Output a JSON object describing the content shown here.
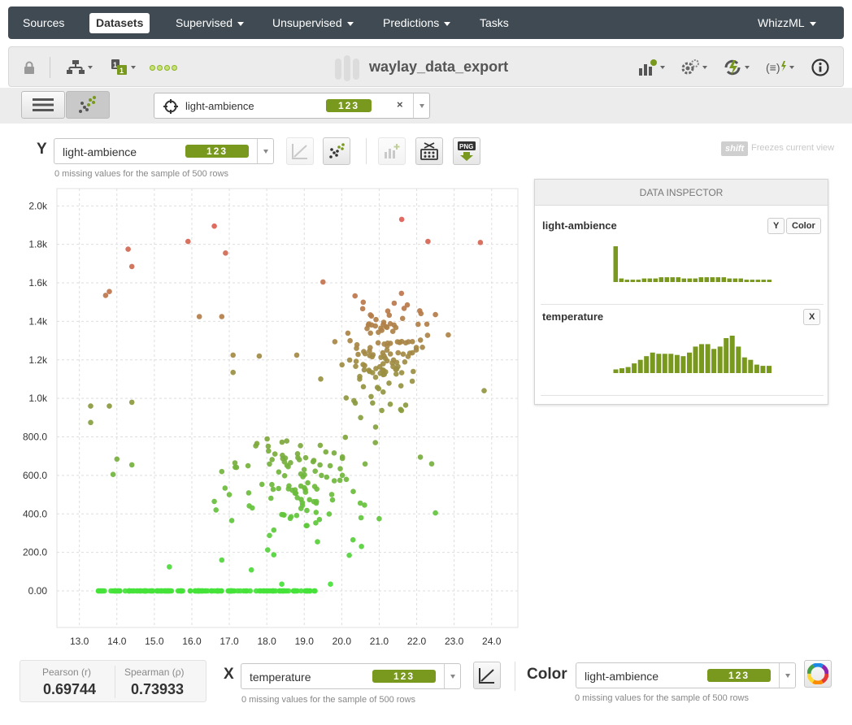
{
  "nav": {
    "items": [
      "Sources",
      "Datasets",
      "Supervised",
      "Unsupervised",
      "Predictions",
      "Tasks"
    ],
    "right": "WhizzML"
  },
  "toolbar": {
    "title": "waylay_data_export"
  },
  "field_selector": {
    "name": "light-ambience",
    "type_badge": "123"
  },
  "y_axis": {
    "letter": "Y",
    "field": "light-ambience",
    "type_badge": "123",
    "missing_note": "0 missing values for the sample of 500 rows"
  },
  "shift_hint": {
    "key": "shift",
    "text": "Freezes current view"
  },
  "x_axis": {
    "letter": "X",
    "field": "temperature",
    "type_badge": "123",
    "missing_note": "0 missing values for the sample of 500 rows"
  },
  "color_axis": {
    "label": "Color",
    "field": "light-ambience",
    "type_badge": "123",
    "missing_note": "0 missing values for the sample of 500 rows"
  },
  "correlation": {
    "pearson_label": "Pearson (r)",
    "pearson_value": "0.69744",
    "spearman_label": "Spearman (ρ)",
    "spearman_value": "0.73933"
  },
  "inspector": {
    "title": "DATA INSPECTOR",
    "fields": [
      {
        "name": "light-ambience",
        "buttons": [
          "Y",
          "Color"
        ],
        "histogram": [
          30,
          3,
          2,
          2,
          2,
          3,
          3,
          3,
          4,
          4,
          4,
          4,
          3,
          3,
          3,
          4,
          4,
          4,
          4,
          4,
          3,
          3,
          3,
          2,
          2,
          2,
          2,
          2
        ],
        "color": "#78991e"
      },
      {
        "name": "temperature",
        "buttons": [
          "X"
        ],
        "histogram": [
          3,
          4,
          5,
          8,
          11,
          14,
          17,
          16,
          16,
          16,
          15,
          14,
          17,
          22,
          24,
          24,
          20,
          22,
          29,
          31,
          22,
          13,
          11,
          7,
          6,
          6
        ],
        "color": "#78991e"
      }
    ]
  },
  "chart_data": {
    "type": "scatter",
    "x_ticks": [
      "13.0",
      "14.0",
      "15.0",
      "16.0",
      "17.0",
      "18.0",
      "19.0",
      "20.0",
      "21.0",
      "22.0",
      "23.0",
      "24.0"
    ],
    "y_ticks": [
      "0.00",
      "200.0",
      "400.0",
      "600.0",
      "800.0",
      "1.0k",
      "1.2k",
      "1.4k",
      "1.6k",
      "1.8k",
      "2.0k"
    ],
    "xlim": [
      12.4,
      24.7
    ],
    "ylim": [
      -190,
      2090
    ],
    "color_low": "#45e23a",
    "color_high": "#e05d55",
    "x_field": "temperature",
    "y_field": "light-ambience"
  }
}
